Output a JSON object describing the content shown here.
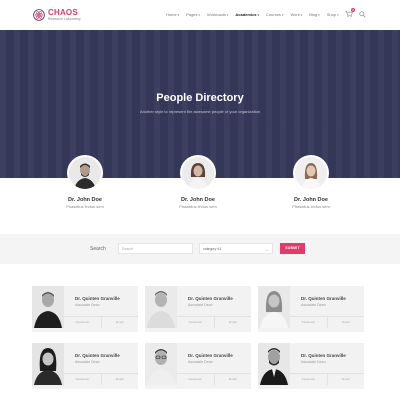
{
  "logo": {
    "name": "CHAOS",
    "tagline": "Research Laboratory"
  },
  "nav": [
    {
      "label": "Home",
      "active": false
    },
    {
      "label": "Pages",
      "active": false
    },
    {
      "label": "Workloads",
      "active": false
    },
    {
      "label": "Academics",
      "active": true
    },
    {
      "label": "Courses",
      "active": false
    },
    {
      "label": "Work",
      "active": false
    },
    {
      "label": "Blog",
      "active": false
    },
    {
      "label": "Shop",
      "active": false
    }
  ],
  "cart": {
    "count": "0"
  },
  "hero": {
    "title": "People Directory",
    "subtitle": "Another style to represent the awesome people of your organization"
  },
  "featured": [
    {
      "name": "Dr. John Doe",
      "desc": "Phasellus lectus sem"
    },
    {
      "name": "Dr. John Doe",
      "desc": "Phasellus lectus sem"
    },
    {
      "name": "Dr. John Doe",
      "desc": "Phasellus lectus sem"
    }
  ],
  "search": {
    "label": "Search",
    "placeholder": "Search",
    "category": "category #1",
    "submit": "SUBMIT"
  },
  "cards": [
    {
      "name": "Dr. Quinten Granville",
      "role": "Associate Dean",
      "a1": "Facebook",
      "a2": "Email"
    },
    {
      "name": "Dr. Quinten Granville",
      "role": "Associate Dean",
      "a1": "Facebook",
      "a2": "Email"
    },
    {
      "name": "Dr. Quinten Granville",
      "role": "Associate Dean",
      "a1": "Facebook",
      "a2": "Email"
    },
    {
      "name": "Dr. Quinten Granville",
      "role": "Associate Dean",
      "a1": "Facebook",
      "a2": "Email"
    },
    {
      "name": "Dr. Quinten Granville",
      "role": "Associate Dean",
      "a1": "Facebook",
      "a2": "Email"
    },
    {
      "name": "Dr. Quinten Granville",
      "role": "Associate Dean",
      "a1": "Facebook",
      "a2": "Email"
    }
  ],
  "colors": {
    "accent": "#e23a6a",
    "hero": "#373a5c"
  }
}
